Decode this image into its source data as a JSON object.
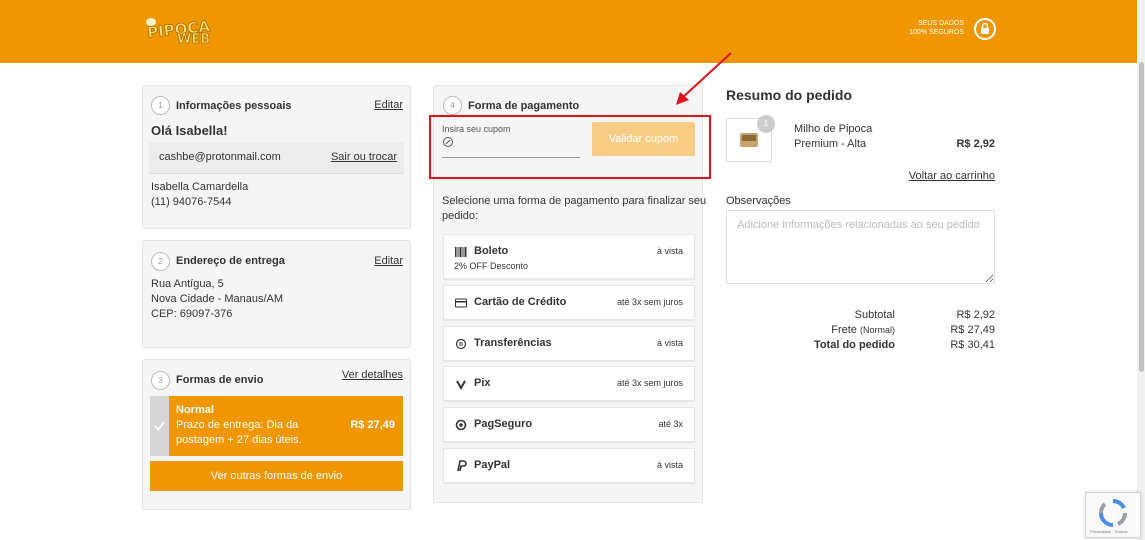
{
  "header": {
    "logo_text": "PIPOCA WEB",
    "secure_line1": "SEUS DADOS",
    "secure_line2": "100% SEGUROS",
    "bg_color": "#ef9600"
  },
  "personal": {
    "step": "1",
    "title": "Informações pessoais",
    "edit_label": "Editar",
    "greeting": "Olá Isabella!",
    "email": "cashbe@protonmail.com",
    "logout_label": "Sair ou trocar",
    "name": "Isabella Camardella",
    "phone": "(11) 94076-7544"
  },
  "address": {
    "step": "2",
    "title": "Endereço de entrega",
    "edit_label": "Editar",
    "line1": "Rua Antígua, 5",
    "line2": "Nova Cidade - Manaus/AM",
    "line3": "CEP: 69097-376"
  },
  "shipping": {
    "step": "3",
    "title": "Formas de envio",
    "details_label": "Ver detalhes",
    "option": {
      "name": "Normal",
      "desc_line1": "Prazo de entrega: Dia da",
      "desc_line2": "postagem + 27 dias úteis.",
      "price": "R$ 27,49",
      "selected": true
    },
    "other_button": "Ver outras formas de envio"
  },
  "payment": {
    "step": "4",
    "title": "Forma de pagamento",
    "coupon_label": "Insira seu cupom",
    "coupon_value": "",
    "coupon_button": "Validar cupom",
    "instruction_line1": "Selecione uma forma de pagamento para finalizar seu",
    "instruction_line2": "pedido:",
    "methods": [
      {
        "name": "Boleto",
        "sub": "2% OFF Desconto",
        "cond": "à vista",
        "icon": "barcode-icon"
      },
      {
        "name": "Cartão de Crédito",
        "sub": "",
        "cond": "até 3x sem juros",
        "icon": "credit-card-icon"
      },
      {
        "name": "Transferências",
        "sub": "",
        "cond": "à vista",
        "icon": "transfer-icon"
      },
      {
        "name": "Pix",
        "sub": "",
        "cond": "até 3x sem juros",
        "icon": "pix-icon"
      },
      {
        "name": "PagSeguro",
        "sub": "",
        "cond": "até 3x",
        "icon": "pagseguro-icon"
      },
      {
        "name": "PayPal",
        "sub": "",
        "cond": "à vista",
        "icon": "paypal-icon"
      }
    ]
  },
  "summary": {
    "title": "Resumo do pedido",
    "product": {
      "qty": "1",
      "name_line1": "Milho de Pipoca",
      "name_line2": "Premium - Alta",
      "price": "R$ 2,92"
    },
    "back_link": "Voltar ao carrinho",
    "obs_label": "Observações",
    "obs_placeholder": "Adicione informações relacionadas ao seu pedido",
    "subtotal_label": "Subtotal",
    "subtotal_value": "R$ 2,92",
    "freight_label": "Frete",
    "freight_note": "(Normal)",
    "freight_value": "R$ 27,49",
    "total_label": "Total do pedido",
    "total_value": "R$ 30,41"
  },
  "annotation": {
    "highlight_color": "#e4101c"
  },
  "recaptcha": {
    "text": "Privacidade - Termos"
  }
}
